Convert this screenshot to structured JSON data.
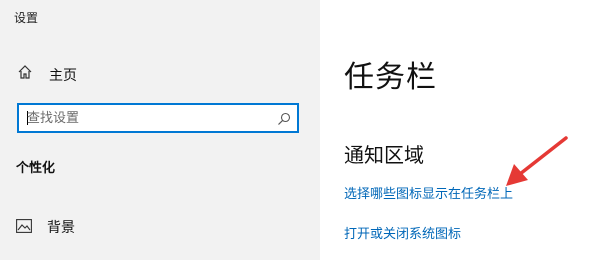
{
  "window": {
    "title": "设置"
  },
  "sidebar": {
    "home": {
      "label": "主页",
      "icon": "home-icon"
    },
    "search": {
      "placeholder": "查找设置",
      "value": "",
      "icon": "search-icon"
    },
    "section_heading": "个性化",
    "items": [
      {
        "label": "背景",
        "icon": "image-icon"
      }
    ]
  },
  "main": {
    "title": "任务栏",
    "section_title": "通知区域",
    "links": [
      {
        "label": "选择哪些图标显示在任务栏上"
      },
      {
        "label": "打开或关闭系统图标"
      }
    ]
  },
  "colors": {
    "accent": "#0078d4",
    "link": "#0067b8",
    "sidebar_bg": "#f2f2f2",
    "annotation_arrow": "#e53935"
  }
}
